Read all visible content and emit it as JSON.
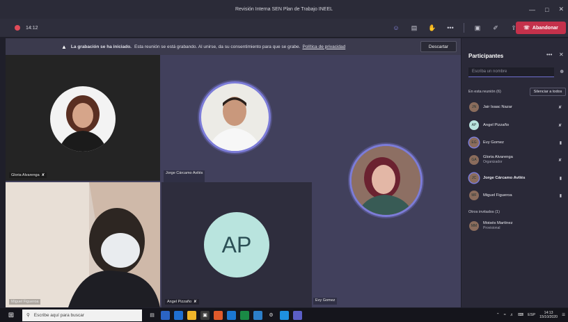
{
  "window": {
    "title": "Revisión Interna SEN Plan de Trabajo INEEL",
    "controls": [
      "—",
      "□",
      "✕"
    ]
  },
  "toolbar": {
    "timer": "14:12",
    "icons": [
      {
        "name": "participants-icon",
        "glyph": "☺"
      },
      {
        "name": "chat-icon",
        "glyph": "▤"
      },
      {
        "name": "raise-hand-icon",
        "glyph": "✋"
      },
      {
        "name": "more-options-icon",
        "glyph": "•••"
      },
      {
        "name": "camera-icon",
        "glyph": "▣"
      },
      {
        "name": "microphone-icon",
        "glyph": "✐"
      },
      {
        "name": "share-screen-icon",
        "glyph": "⇪"
      }
    ],
    "leave_label": "Abandonar",
    "leave_color": "#c4314b"
  },
  "banner": {
    "bold": "La grabación se ha iniciado.",
    "text": "Esta reunión se está grabando. Al unirse, da su consentimiento para que se grabe.",
    "link": "Política de privacidad",
    "dismiss_label": "Descartar"
  },
  "tiles": [
    {
      "name": "Gloria Alvarenga"
    },
    {
      "name": "Jorge Cárcamo Avilés"
    },
    {
      "name": "Miguel Figueroa"
    },
    {
      "name": "Angel Pizzaño",
      "initials": "AP"
    },
    {
      "name": "Evy Gomez"
    }
  ],
  "panel": {
    "title": "Participantes",
    "search_placeholder": "Escriba un nombre",
    "in_meeting_label": "En esta reunión (6)",
    "mute_all_label": "Silenciar a todos",
    "participants": [
      {
        "name": "Jair Isaac Nazar",
        "sub": "",
        "initials": "JN"
      },
      {
        "name": "Angel Pizzaño",
        "sub": "",
        "initials": "AP"
      },
      {
        "name": "Evy Gomez",
        "sub": "",
        "initials": "EG"
      },
      {
        "name": "Gloria Alvarenga",
        "sub": "Organizador",
        "initials": "GA"
      },
      {
        "name": "Jorge Cárcamo Avilés",
        "sub": "",
        "initials": "JC"
      },
      {
        "name": "Miguel Figueroa",
        "sub": "",
        "initials": "MF"
      }
    ],
    "others_label": "Otros invitados (1)",
    "others": [
      {
        "name": "Moisés Martínez",
        "sub": "Provisional",
        "initials": "MM"
      }
    ]
  },
  "taskbar": {
    "search_placeholder": "Escribe aquí para buscar",
    "lang": "ESP",
    "time": "14:13",
    "date": "15/10/2020"
  },
  "colors": {
    "accent": "#7c7cd8",
    "stage_bg": "#41405c",
    "panel_bg": "#2a2938"
  }
}
